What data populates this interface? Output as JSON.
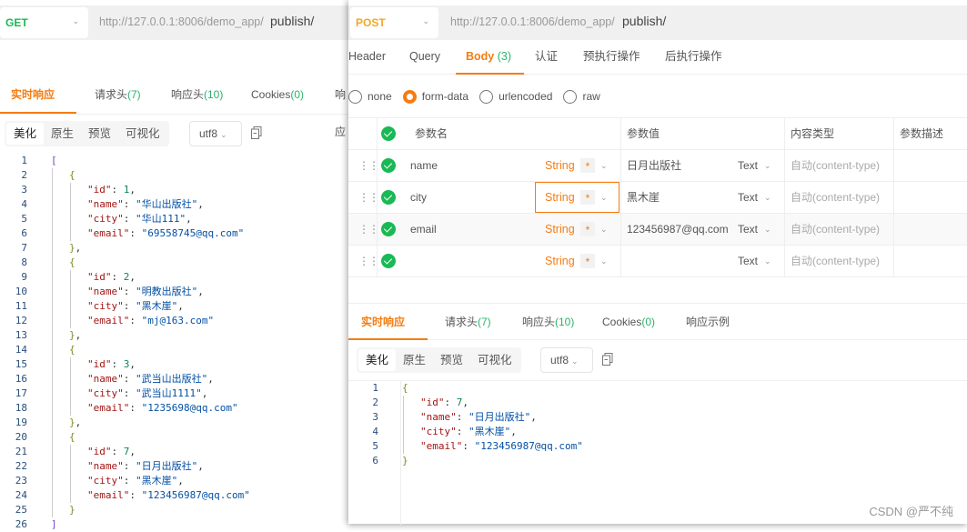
{
  "left_window": {
    "method": "GET",
    "method_color": "#19b955",
    "url_base": "http://127.0.0.1:8006/demo_app/",
    "url_path": "publish/",
    "response_tabs": [
      {
        "label": "实时响应",
        "count": ""
      },
      {
        "label": "请求头",
        "count": "(7)"
      },
      {
        "label": "响应头",
        "count": "(10)"
      },
      {
        "label": "Cookies",
        "count": "(0)"
      },
      {
        "label": "响应",
        "count": ""
      }
    ],
    "format_buttons": [
      "美化",
      "原生",
      "预览",
      "可视化"
    ],
    "encoding": "utf8",
    "code_lines": [
      {
        "n": "1",
        "t": [
          [
            "b1",
            "["
          ]
        ],
        "i": 0
      },
      {
        "n": "2",
        "t": [
          [
            "b2",
            "{"
          ]
        ],
        "i": 1
      },
      {
        "n": "3",
        "t": [
          [
            "k",
            "\"id\""
          ],
          [
            "p",
            ": "
          ],
          [
            "n",
            "1"
          ],
          [
            "p",
            ","
          ]
        ],
        "i": 2
      },
      {
        "n": "4",
        "t": [
          [
            "k",
            "\"name\""
          ],
          [
            "p",
            ": "
          ],
          [
            "s",
            "\"华山出版社\""
          ],
          [
            "p",
            ","
          ]
        ],
        "i": 2
      },
      {
        "n": "5",
        "t": [
          [
            "k",
            "\"city\""
          ],
          [
            "p",
            ": "
          ],
          [
            "s",
            "\"华山111\""
          ],
          [
            "p",
            ","
          ]
        ],
        "i": 2
      },
      {
        "n": "6",
        "t": [
          [
            "k",
            "\"email\""
          ],
          [
            "p",
            ": "
          ],
          [
            "s",
            "\"69558745@qq.com\""
          ]
        ],
        "i": 2
      },
      {
        "n": "7",
        "t": [
          [
            "b2",
            "}"
          ],
          [
            "p",
            ","
          ]
        ],
        "i": 1
      },
      {
        "n": "8",
        "t": [
          [
            "b2",
            "{"
          ]
        ],
        "i": 1
      },
      {
        "n": "9",
        "t": [
          [
            "k",
            "\"id\""
          ],
          [
            "p",
            ": "
          ],
          [
            "n",
            "2"
          ],
          [
            "p",
            ","
          ]
        ],
        "i": 2
      },
      {
        "n": "10",
        "t": [
          [
            "k",
            "\"name\""
          ],
          [
            "p",
            ": "
          ],
          [
            "s",
            "\"明教出版社\""
          ],
          [
            "p",
            ","
          ]
        ],
        "i": 2
      },
      {
        "n": "11",
        "t": [
          [
            "k",
            "\"city\""
          ],
          [
            "p",
            ": "
          ],
          [
            "s",
            "\"黑木崖\""
          ],
          [
            "p",
            ","
          ]
        ],
        "i": 2
      },
      {
        "n": "12",
        "t": [
          [
            "k",
            "\"email\""
          ],
          [
            "p",
            ": "
          ],
          [
            "s",
            "\"mj@163.com\""
          ]
        ],
        "i": 2
      },
      {
        "n": "13",
        "t": [
          [
            "b2",
            "}"
          ],
          [
            "p",
            ","
          ]
        ],
        "i": 1
      },
      {
        "n": "14",
        "t": [
          [
            "b2",
            "{"
          ]
        ],
        "i": 1
      },
      {
        "n": "15",
        "t": [
          [
            "k",
            "\"id\""
          ],
          [
            "p",
            ": "
          ],
          [
            "n",
            "3"
          ],
          [
            "p",
            ","
          ]
        ],
        "i": 2
      },
      {
        "n": "16",
        "t": [
          [
            "k",
            "\"name\""
          ],
          [
            "p",
            ": "
          ],
          [
            "s",
            "\"武当山出版社\""
          ],
          [
            "p",
            ","
          ]
        ],
        "i": 2
      },
      {
        "n": "17",
        "t": [
          [
            "k",
            "\"city\""
          ],
          [
            "p",
            ": "
          ],
          [
            "s",
            "\"武当山1111\""
          ],
          [
            "p",
            ","
          ]
        ],
        "i": 2
      },
      {
        "n": "18",
        "t": [
          [
            "k",
            "\"email\""
          ],
          [
            "p",
            ": "
          ],
          [
            "s",
            "\"1235698@qq.com\""
          ]
        ],
        "i": 2
      },
      {
        "n": "19",
        "t": [
          [
            "b2",
            "}"
          ],
          [
            "p",
            ","
          ]
        ],
        "i": 1
      },
      {
        "n": "20",
        "t": [
          [
            "b2",
            "{"
          ]
        ],
        "i": 1
      },
      {
        "n": "21",
        "t": [
          [
            "k",
            "\"id\""
          ],
          [
            "p",
            ": "
          ],
          [
            "n",
            "7"
          ],
          [
            "p",
            ","
          ]
        ],
        "i": 2
      },
      {
        "n": "22",
        "t": [
          [
            "k",
            "\"name\""
          ],
          [
            "p",
            ": "
          ],
          [
            "s",
            "\"日月出版社\""
          ],
          [
            "p",
            ","
          ]
        ],
        "i": 2
      },
      {
        "n": "23",
        "t": [
          [
            "k",
            "\"city\""
          ],
          [
            "p",
            ": "
          ],
          [
            "s",
            "\"黑木崖\""
          ],
          [
            "p",
            ","
          ]
        ],
        "i": 2
      },
      {
        "n": "24",
        "t": [
          [
            "k",
            "\"email\""
          ],
          [
            "p",
            ": "
          ],
          [
            "s",
            "\"123456987@qq.com\""
          ]
        ],
        "i": 2
      },
      {
        "n": "25",
        "t": [
          [
            "b2",
            "}"
          ]
        ],
        "i": 1
      },
      {
        "n": "26",
        "t": [
          [
            "b1",
            "]"
          ]
        ],
        "i": 0
      }
    ]
  },
  "right_window": {
    "method": "POST",
    "method_color": "#f5a623",
    "url_base": "http://127.0.0.1:8006/demo_app/",
    "url_path": "publish/",
    "request_tabs": [
      {
        "label": "Header",
        "count": ""
      },
      {
        "label": "Query",
        "count": ""
      },
      {
        "label": "Body",
        "count": " (3)"
      },
      {
        "label": "认证",
        "count": ""
      },
      {
        "label": "预执行操作",
        "count": ""
      },
      {
        "label": "后执行操作",
        "count": ""
      }
    ],
    "active_request_tab": "Body",
    "body_types": [
      "none",
      "form-data",
      "urlencoded",
      "raw"
    ],
    "selected_body_type": "form-data",
    "params_table": {
      "headers": [
        "参数名",
        "参数值",
        "内容类型",
        "参数描述"
      ],
      "rows": [
        {
          "name": "name",
          "type": "String",
          "required": "*",
          "value": "日月出版社",
          "value_type": "Text",
          "content_type": "自动(content-type)",
          "description": ""
        },
        {
          "name": "city",
          "type": "String",
          "required": "*",
          "value": "黑木崖",
          "value_type": "Text",
          "content_type": "自动(content-type)",
          "description": ""
        },
        {
          "name": "email",
          "type": "String",
          "required": "*",
          "value": "123456987@qq.com",
          "value_type": "Text",
          "content_type": "自动(content-type)",
          "description": ""
        },
        {
          "name": "",
          "type": "String",
          "required": "*",
          "value": "",
          "value_type": "Text",
          "content_type": "自动(content-type)",
          "description": ""
        }
      ]
    },
    "response_tabs": [
      {
        "label": "实时响应",
        "count": ""
      },
      {
        "label": "请求头",
        "count": "(7)"
      },
      {
        "label": "响应头",
        "count": "(10)"
      },
      {
        "label": "Cookies",
        "count": "(0)"
      },
      {
        "label": "响应示例",
        "count": ""
      }
    ],
    "format_buttons": [
      "美化",
      "原生",
      "预览",
      "可视化"
    ],
    "encoding": "utf8",
    "code_lines": [
      {
        "n": "1",
        "t": [
          [
            "b2",
            "{"
          ]
        ],
        "i": 0
      },
      {
        "n": "2",
        "t": [
          [
            "k",
            "\"id\""
          ],
          [
            "p",
            ": "
          ],
          [
            "n",
            "7"
          ],
          [
            "p",
            ","
          ]
        ],
        "i": 1
      },
      {
        "n": "3",
        "t": [
          [
            "k",
            "\"name\""
          ],
          [
            "p",
            ": "
          ],
          [
            "s",
            "\"日月出版社\""
          ],
          [
            "p",
            ","
          ]
        ],
        "i": 1
      },
      {
        "n": "4",
        "t": [
          [
            "k",
            "\"city\""
          ],
          [
            "p",
            ": "
          ],
          [
            "s",
            "\"黑木崖\""
          ],
          [
            "p",
            ","
          ]
        ],
        "i": 1
      },
      {
        "n": "5",
        "t": [
          [
            "k",
            "\"email\""
          ],
          [
            "p",
            ": "
          ],
          [
            "s",
            "\"123456987@qq.com\""
          ]
        ],
        "i": 1
      },
      {
        "n": "6",
        "t": [
          [
            "b2",
            "}"
          ]
        ],
        "i": 0
      }
    ]
  },
  "accent_color": "#f47c12",
  "success_color": "#19b955",
  "watermark": "CSDN @严不纯"
}
